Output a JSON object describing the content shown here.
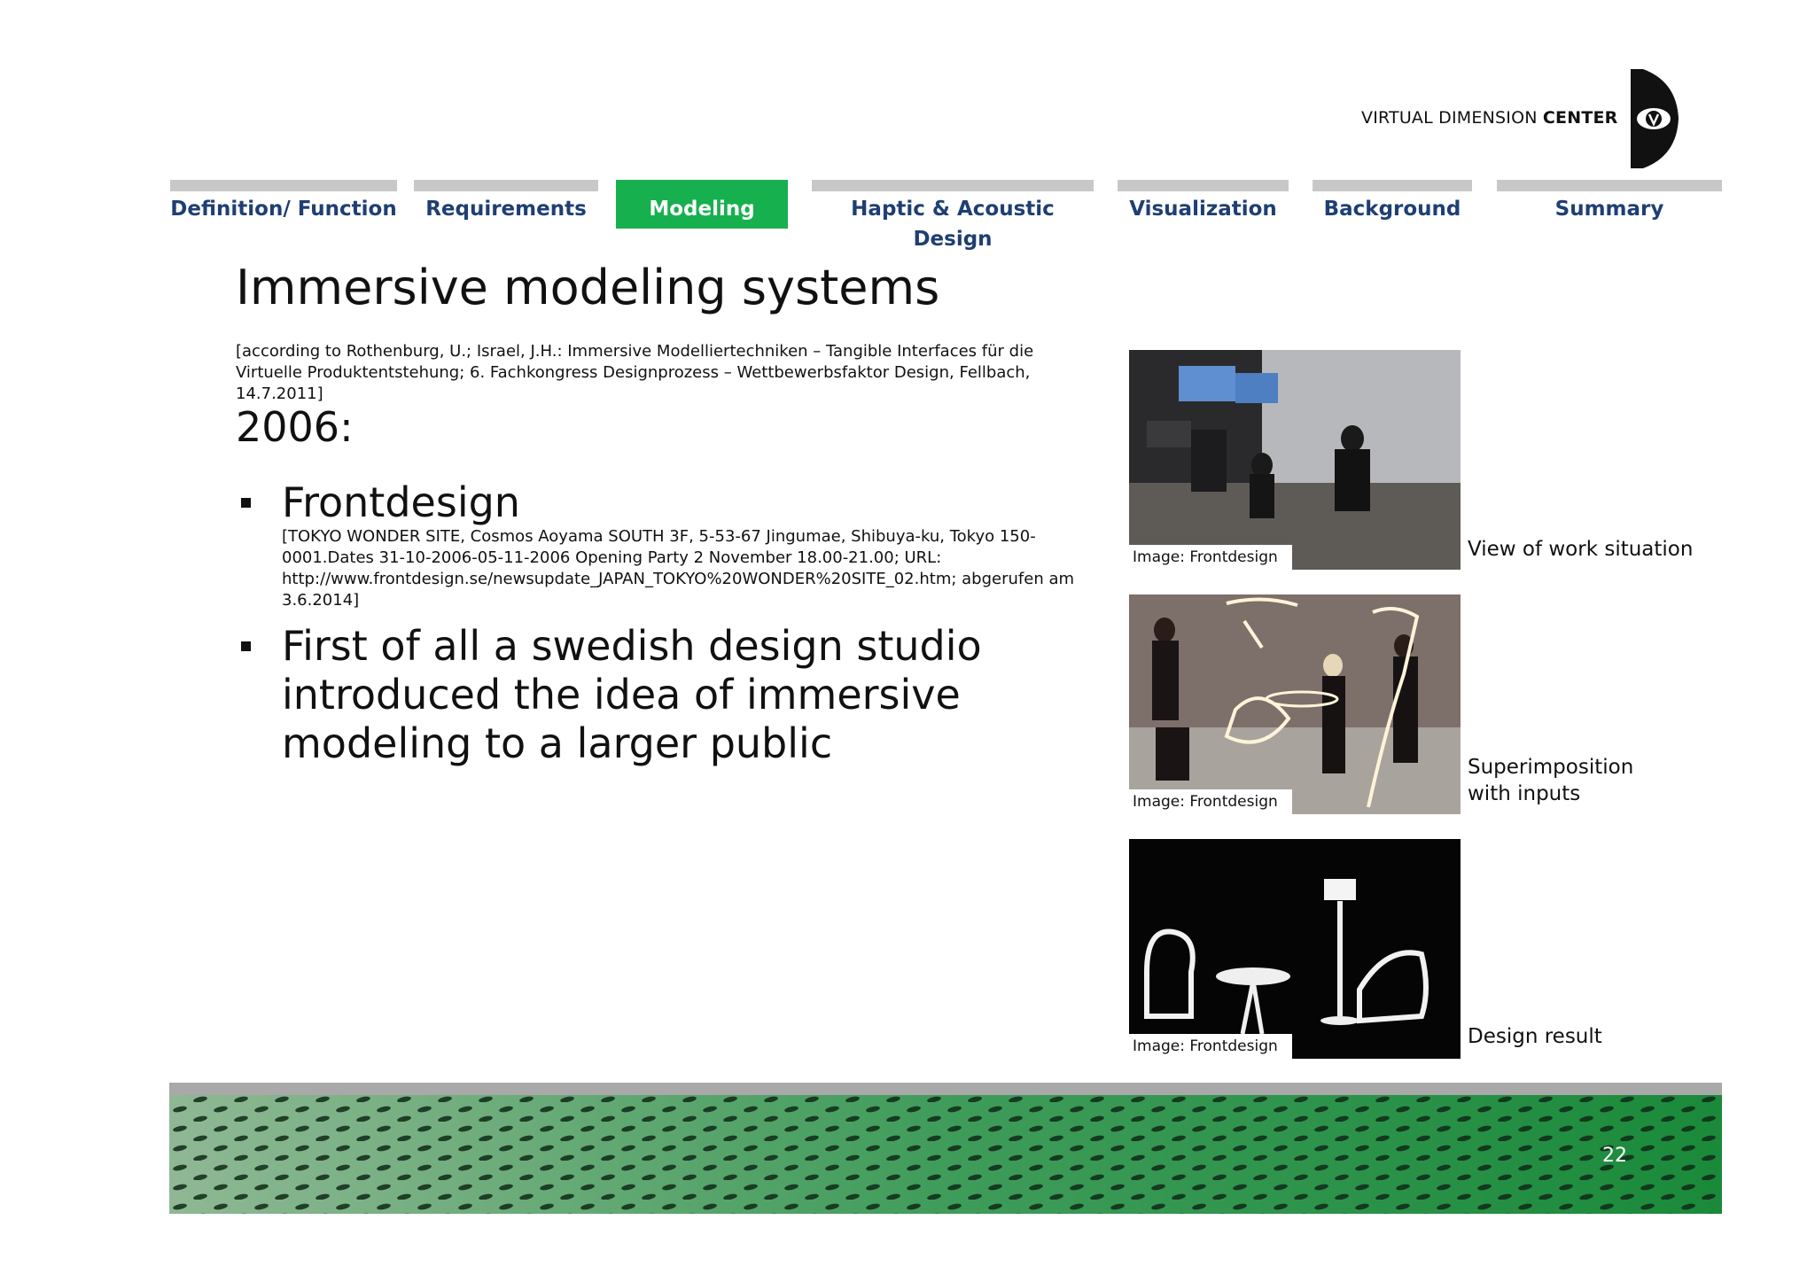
{
  "logo": {
    "text_regular": "VIRTUAL DIMENSION",
    "text_bold": "CENTER"
  },
  "nav": {
    "tabs": [
      {
        "label": "Definition/ Function"
      },
      {
        "label": "Requirements"
      },
      {
        "label": "Modeling"
      },
      {
        "label": "Haptic & Acoustic Design"
      },
      {
        "label": "Visualization"
      },
      {
        "label": "Background"
      },
      {
        "label": "Summary"
      }
    ],
    "active": "Modeling"
  },
  "slide": {
    "title": "Immersive modeling systems",
    "reference": "[according to Rothenburg, U.; Israel, J.H.: Immersive Modelliertechniken – Tangible Interfaces für die Virtuelle Produktentstehung; 6. Fachkongress Designprozess – Wettbewerbsfaktor Design, Fellbach, 14.7.2011]",
    "year": "2006:",
    "bullets": [
      {
        "text": "Frontdesign",
        "sub": "[TOKYO WONDER SITE, Cosmos Aoyama SOUTH 3F, 5-53-67 Jingumae, Shibuya-ku, Tokyo 150-0001.Dates 31-10-2006-05-11-2006 Opening Party 2 November 18.00-21.00; URL: http://www.frontdesign.se/newsupdate_JAPAN_TOKYO%20WONDER%20SITE_02.htm; abgerufen am 3.6.2014]"
      },
      {
        "text": "First of all a swedish design studio introduced the idea of immersive modeling to a larger public"
      }
    ]
  },
  "images": [
    {
      "caption": "Image: Frontdesign",
      "side_label": "View of work situation"
    },
    {
      "caption": "Image: Frontdesign",
      "side_label": "Superimposition with inputs"
    },
    {
      "caption": "Image: Frontdesign",
      "side_label": "Design result"
    }
  ],
  "footer": {
    "page_number": "22"
  },
  "colors": {
    "accent_green": "#17b04f",
    "nav_text": "#1f3f73",
    "tab_bar": "#c8c8c8"
  }
}
